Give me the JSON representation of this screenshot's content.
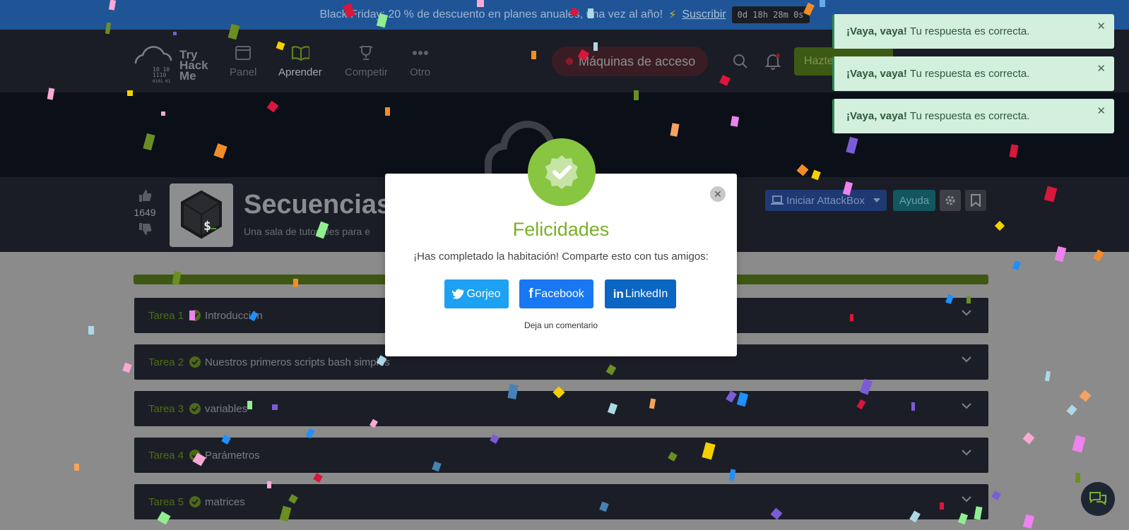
{
  "promo": {
    "text": "Black Friday: 20 % de descuento en planes anuales, una vez al año!",
    "subscribe_label": "Suscribir",
    "timer": "0d 18h 28m 0s"
  },
  "nav": {
    "logo_text": [
      "Try",
      "Hack",
      "Me"
    ],
    "items": [
      {
        "label": "Panel"
      },
      {
        "label": "Aprender"
      },
      {
        "label": "Competir"
      },
      {
        "label": "Otro"
      }
    ],
    "access_label": "Máquinas de acceso",
    "hazte_label": "Hazte"
  },
  "room": {
    "votes": "1649",
    "title": "Secuencias",
    "subtitle": "Una sala de tutoriales para e",
    "attackbox_label": "Iniciar AttackBox",
    "help_label": "Ayuda"
  },
  "tasks": [
    {
      "num": "Tarea 1",
      "title": "Introducción"
    },
    {
      "num": "Tarea 2",
      "title": "Nuestros primeros scripts bash simples"
    },
    {
      "num": "Tarea 3",
      "title": "variables"
    },
    {
      "num": "Tarea 4",
      "title": "Parámetros"
    },
    {
      "num": "Tarea 5",
      "title": "matrices"
    }
  ],
  "toasts": [
    {
      "bold": "¡Vaya, vaya!",
      "text": "Tu respuesta es correcta."
    },
    {
      "bold": "¡Vaya, vaya!",
      "text": "Tu respuesta es correcta."
    },
    {
      "bold": "¡Vaya, vaya!",
      "text": "Tu respuesta es correcta."
    }
  ],
  "modal": {
    "title": "Felicidades",
    "message": "¡Has completado la habitación! Comparte esto con tus amigos:",
    "twitter_label": "Gorjeo",
    "facebook_label": "Facebook",
    "linkedin_label": "LinkedIn",
    "comment_label": "Deja un comentario"
  },
  "colors": {
    "accent": "#88c540",
    "banner": "#1f5597",
    "toast_bg": "#d3efdd",
    "overlay": "#8b8b8b"
  }
}
